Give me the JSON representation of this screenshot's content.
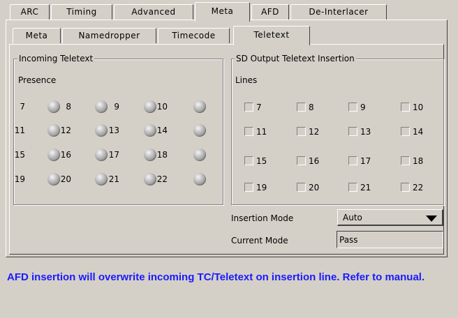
{
  "tabs_main": [
    {
      "label": "ARC",
      "active": false
    },
    {
      "label": "Timing",
      "active": false
    },
    {
      "label": "Advanced",
      "active": false
    },
    {
      "label": "Meta",
      "active": true
    },
    {
      "label": "AFD",
      "active": false
    },
    {
      "label": "De-Interlacer",
      "active": false
    }
  ],
  "tabs_sub": [
    {
      "label": "Meta",
      "active": false
    },
    {
      "label": "Namedropper",
      "active": false
    },
    {
      "label": "Timecode",
      "active": false
    },
    {
      "label": "Teletext",
      "active": true
    }
  ],
  "incoming": {
    "legend": "Incoming Teletext",
    "subheading": "Presence",
    "indicators": [
      {
        "line": "7",
        "state": "off"
      },
      {
        "line": "8",
        "state": "off"
      },
      {
        "line": "9",
        "state": "off"
      },
      {
        "line": "10",
        "state": "off"
      },
      {
        "line": "11",
        "state": "off"
      },
      {
        "line": "12",
        "state": "off"
      },
      {
        "line": "13",
        "state": "off"
      },
      {
        "line": "14",
        "state": "off"
      },
      {
        "line": "15",
        "state": "off"
      },
      {
        "line": "16",
        "state": "off"
      },
      {
        "line": "17",
        "state": "off"
      },
      {
        "line": "18",
        "state": "off"
      },
      {
        "line": "19",
        "state": "off"
      },
      {
        "line": "20",
        "state": "off"
      },
      {
        "line": "21",
        "state": "off"
      },
      {
        "line": "22",
        "state": "off"
      }
    ]
  },
  "insertion": {
    "legend": "SD Output Teletext Insertion",
    "subheading": "Lines",
    "lines": [
      {
        "line": "7",
        "checked": false
      },
      {
        "line": "8",
        "checked": false
      },
      {
        "line": "9",
        "checked": false
      },
      {
        "line": "10",
        "checked": false
      },
      {
        "line": "11",
        "checked": false
      },
      {
        "line": "12",
        "checked": false
      },
      {
        "line": "13",
        "checked": false
      },
      {
        "line": "14",
        "checked": false
      },
      {
        "line": "15",
        "checked": false
      },
      {
        "line": "16",
        "checked": false
      },
      {
        "line": "17",
        "checked": false
      },
      {
        "line": "18",
        "checked": false
      },
      {
        "line": "19",
        "checked": false
      },
      {
        "line": "20",
        "checked": false
      },
      {
        "line": "21",
        "checked": false
      },
      {
        "line": "22",
        "checked": false
      }
    ]
  },
  "insertion_mode": {
    "label": "Insertion Mode",
    "value": "Auto"
  },
  "current_mode": {
    "label": "Current Mode",
    "value": "Pass"
  },
  "message": {
    "text": "AFD insertion will overwrite incoming TC/Teletext on insertion line. Refer to manual.",
    "color": "#1a1aff"
  },
  "colors": {
    "background": "#d4d0c8",
    "led_off": "#a0a0a0"
  },
  "icons": {
    "dropdown": "triangle-down-icon",
    "indicator": "led-icon",
    "checkbox": "checkbox-icon"
  }
}
